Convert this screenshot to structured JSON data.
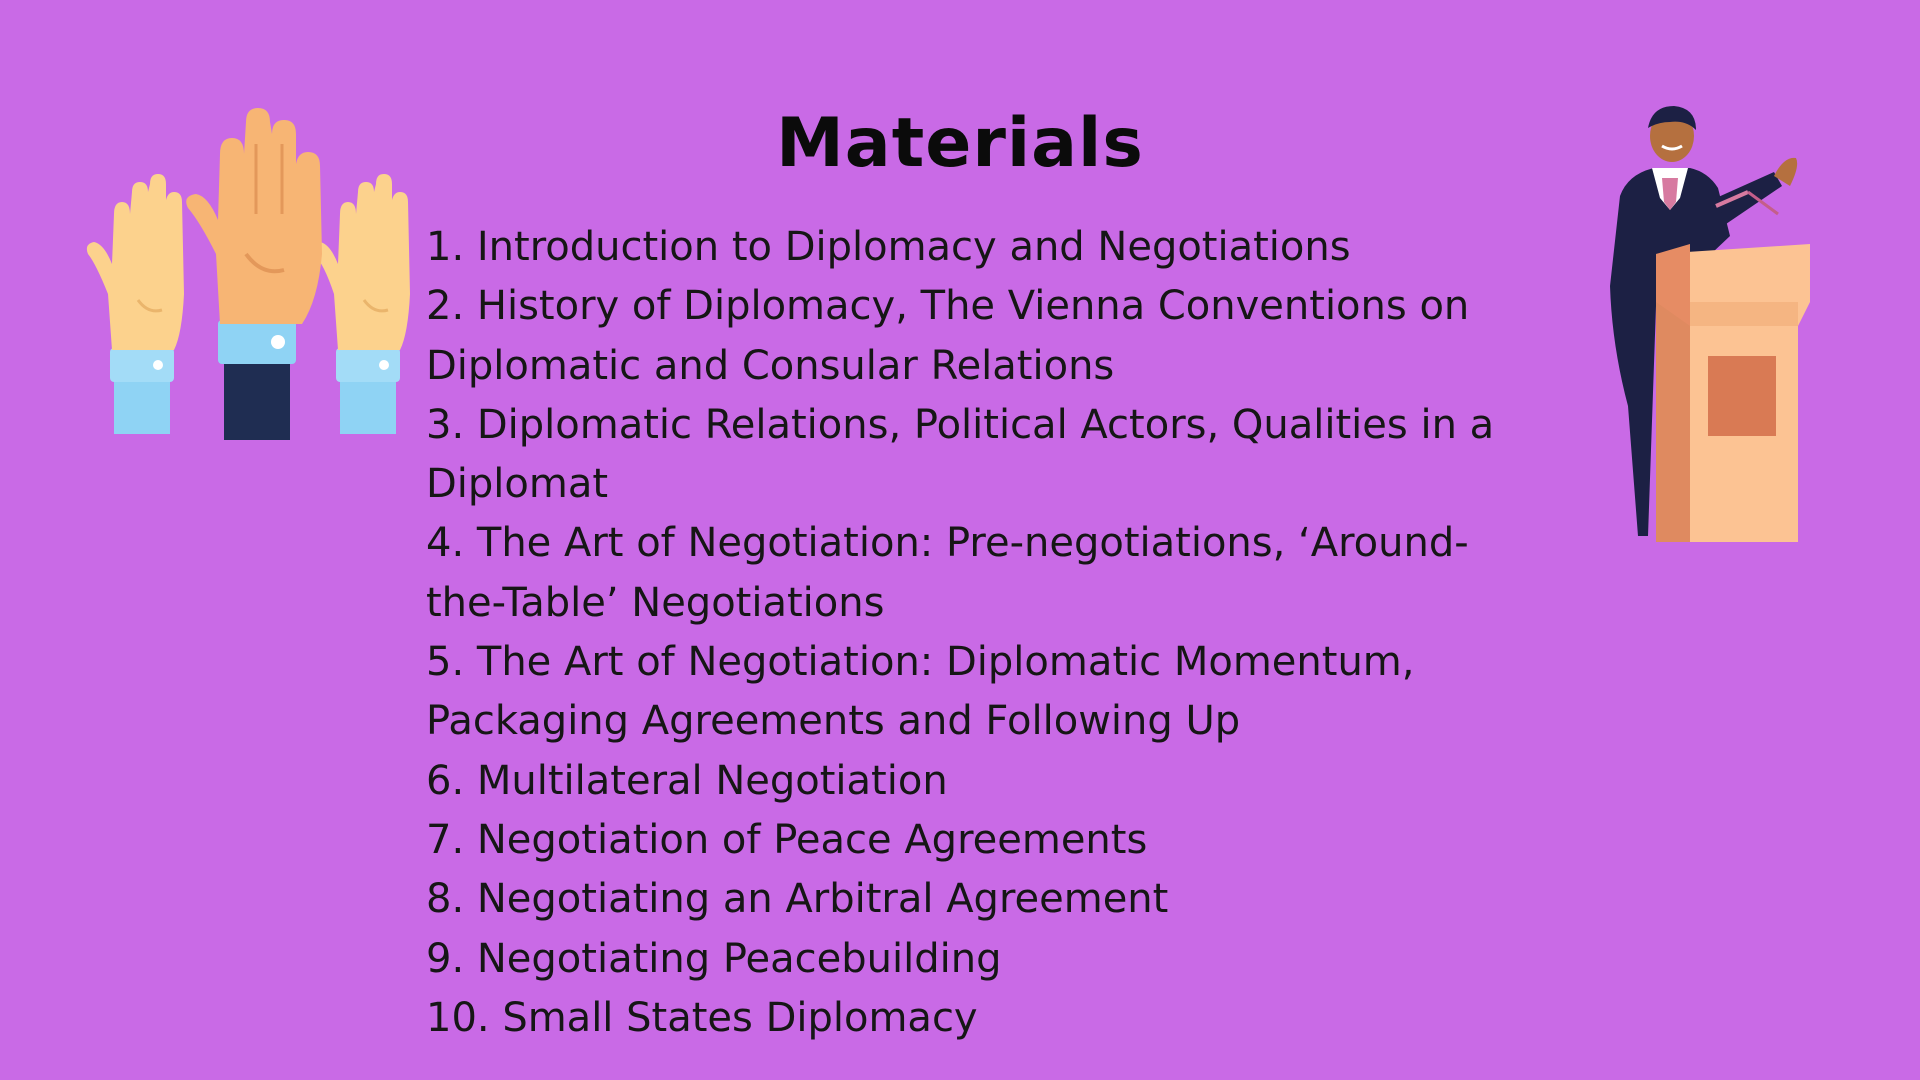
{
  "slide": {
    "title": "Materials",
    "items": [
      "1. Introduction to Diplomacy and Negotiations",
      "2. History of Diplomacy, The Vienna Conventions on Diplomatic and Consular Relations",
      "3. Diplomatic Relations, Political Actors, Qualities in a Diplomat",
      "4. The Art of Negotiation: Pre-negotiations, ‘Around-the-Table’ Negotiations",
      "5. The Art of Negotiation: Diplomatic Momentum, Packaging Agreements and Following Up",
      "6. Multilateral Negotiation",
      "7. Negotiation of Peace Agreements",
      "8. Negotiating an Arbitral Agreement",
      "9. Negotiating Peacebuilding",
      "10. Small States Diplomacy"
    ]
  },
  "theme": {
    "background": "#c96ae6",
    "text": "#111111"
  },
  "illustrations": {
    "left": "raised-hands-icon",
    "right": "speaker-at-podium-icon"
  }
}
